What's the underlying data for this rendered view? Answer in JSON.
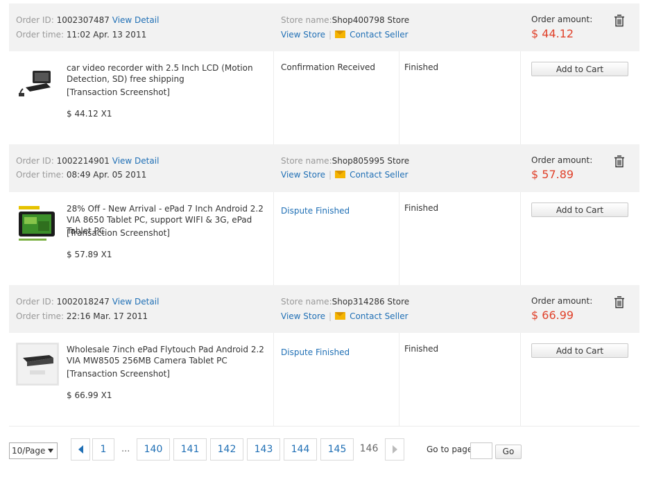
{
  "labels": {
    "order_id": "Order ID:",
    "order_time": "Order time:",
    "view_detail": "View Detail",
    "store_name": "Store name:",
    "view_store": "View Store",
    "separator": "|",
    "contact_seller": "Contact Seller",
    "order_amount": "Order amount:",
    "transaction_screenshot": "[Transaction Screenshot]",
    "add_to_cart": "Add to Cart"
  },
  "orders": [
    {
      "id": "1002307487",
      "time": "11:02 Apr. 13 2011",
      "store": "Shop400798 Store",
      "amount": "$ 44.12",
      "title": "car video recorder with 2.5 Inch LCD (Motion Detection, SD) free shipping",
      "price_qty": "$ 44.12 X1",
      "status": "Confirmation Received",
      "status_is_link": false,
      "state": "Finished"
    },
    {
      "id": "1002214901",
      "time": "08:49 Apr. 05 2011",
      "store": "Shop805995 Store",
      "amount": "$ 57.89",
      "title": "28% Off - New Arrival - ePad 7 Inch Android 2.2 VIA 8650 Tablet PC, support WIFI & 3G, ePad Tablet PC",
      "price_qty": "$ 57.89 X1",
      "status": "Dispute Finished",
      "status_is_link": true,
      "state": "Finished"
    },
    {
      "id": "1002018247",
      "time": "22:16 Mar. 17 2011",
      "store": "Shop314286 Store",
      "amount": "$ 66.99",
      "title": "Wholesale 7inch ePad Flytouch Pad Android 2.2 VIA MW8505 256MB Camera Tablet PC",
      "price_qty": "$ 66.99 X1",
      "status": "Dispute Finished",
      "status_is_link": true,
      "state": "Finished"
    }
  ],
  "pagination": {
    "per_page": "10/Page",
    "first": "1",
    "ellipsis": "...",
    "pages": [
      "140",
      "141",
      "142",
      "143",
      "144",
      "145"
    ],
    "current": "146",
    "goto_label": "Go to page",
    "goto_value": "",
    "go_label": "Go"
  },
  "colors": {
    "link": "#1f6fb5",
    "amount": "#e0412a",
    "header_bg": "#f2f2f2",
    "mail_icon": "#f5b400"
  },
  "icons": [
    "trash-icon",
    "mail-icon",
    "chevron-left-icon",
    "chevron-right-icon",
    "dropdown-caret-icon"
  ]
}
